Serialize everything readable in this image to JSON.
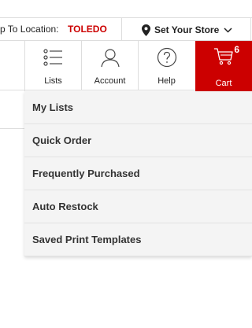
{
  "topbar": {
    "ship_label": "p To Location:",
    "ship_location": "TOLEDO",
    "store_label": "Set Your Store",
    "pin_icon": "map-pin-icon",
    "chevron_icon": "chevron-down-icon"
  },
  "nav": {
    "lists": {
      "label": "Lists",
      "icon": "list-icon"
    },
    "account": {
      "label": "Account",
      "icon": "user-icon"
    },
    "help": {
      "label": "Help",
      "icon": "question-icon"
    },
    "cart": {
      "label": "Cart",
      "icon": "cart-icon",
      "count": "6"
    }
  },
  "dropdown": {
    "items": [
      {
        "label": "My Lists"
      },
      {
        "label": "Quick Order"
      },
      {
        "label": "Frequently Purchased"
      },
      {
        "label": "Auto Restock"
      },
      {
        "label": "Saved Print Templates"
      }
    ]
  },
  "colors": {
    "brand_red": "#cc0000",
    "dropdown_bg": "#f4f4f4",
    "divider": "#dddddd"
  }
}
